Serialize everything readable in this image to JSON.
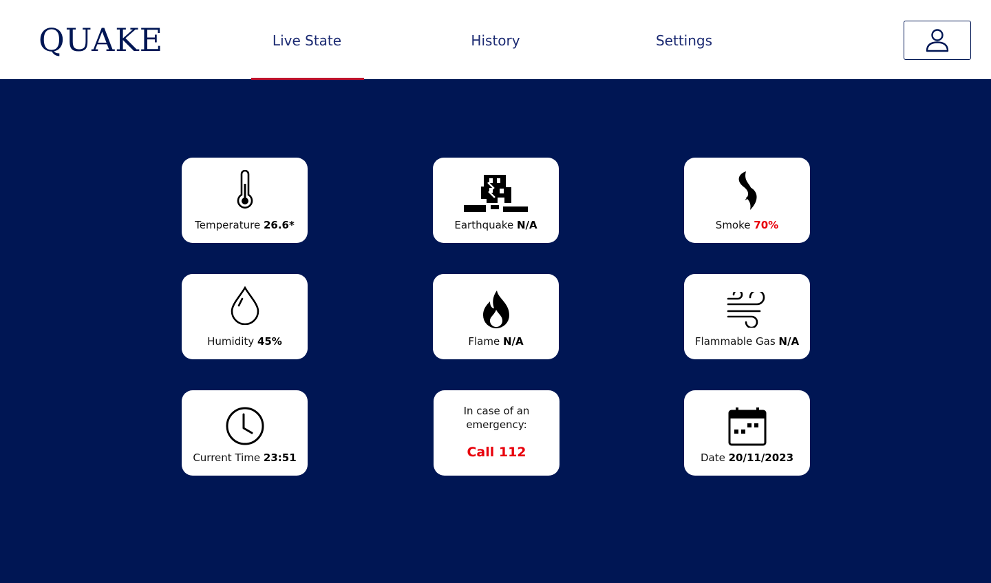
{
  "header": {
    "logo": "QUAKE",
    "nav": [
      {
        "label": "Live State",
        "active": true
      },
      {
        "label": "History",
        "active": false
      },
      {
        "label": "Settings",
        "active": false
      }
    ],
    "user_icon": "user-icon"
  },
  "colors": {
    "background": "#001654",
    "accent": "#c0122c",
    "alert": "#e8000b",
    "card": "#ffffff"
  },
  "cards": {
    "temperature": {
      "label": "Temperature",
      "value": "26.6*",
      "icon": "thermometer-icon"
    },
    "earthquake": {
      "label": "Earthquake",
      "value": "N/A",
      "icon": "earthquake-icon"
    },
    "smoke": {
      "label": "Smoke",
      "value": "70%",
      "icon": "smoke-icon"
    },
    "humidity": {
      "label": "Humidity",
      "value": "45%",
      "icon": "droplet-icon"
    },
    "flame": {
      "label": "Flame",
      "value": "N/A",
      "icon": "flame-icon"
    },
    "gas": {
      "label": "Flammable Gas",
      "value": "N/A",
      "icon": "wind-icon"
    },
    "time": {
      "label": "Current Time",
      "value": "23:51",
      "icon": "clock-icon"
    },
    "emergency": {
      "line1": "In case of an",
      "line2": "emergency:",
      "call": "Call 112"
    },
    "date": {
      "label": "Date",
      "value": "20/11/2023",
      "icon": "calendar-icon"
    }
  }
}
